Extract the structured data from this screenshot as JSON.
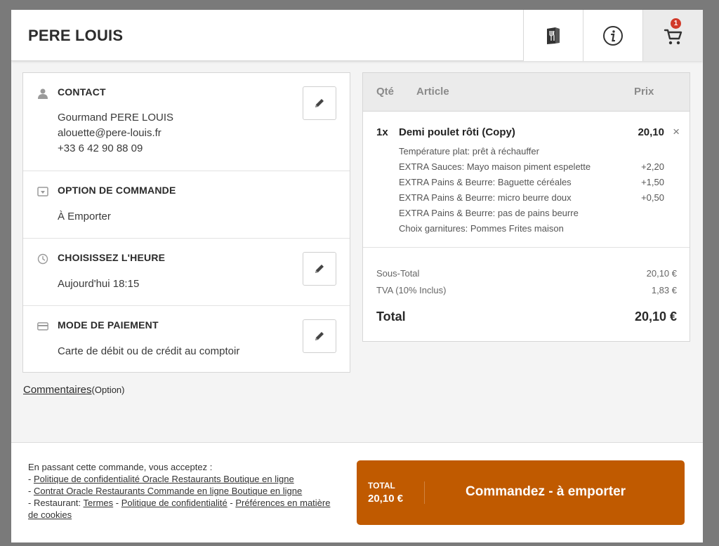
{
  "header": {
    "brand": "PERE LOUIS",
    "cart_count": "1",
    "icons": {
      "menu": "menu-book-icon",
      "info": "info-icon",
      "cart": "cart-icon"
    }
  },
  "contact": {
    "title": "CONTACT",
    "name": "Gourmand PERE LOUIS",
    "email": "alouette@pere-louis.fr",
    "phone": "+33 6 42 90 88 09"
  },
  "order_option": {
    "title": "OPTION DE COMMANDE",
    "value": "À Emporter"
  },
  "time": {
    "title": "CHOISISSEZ L'HEURE",
    "value": "Aujourd'hui 18:15"
  },
  "payment": {
    "title": "MODE DE PAIEMENT",
    "value": "Carte de débit ou de crédit au comptoir"
  },
  "comments": {
    "link": "Commentaires",
    "option": "(Option)"
  },
  "order": {
    "headers": {
      "qty": "Qté",
      "article": "Article",
      "price": "Prix"
    },
    "item": {
      "qty": "1x",
      "name": "Demi poulet rôti (Copy)",
      "price": "20,10",
      "remove": "×",
      "modifiers": [
        {
          "label": "Température plat: prêt à réchauffer",
          "price": ""
        },
        {
          "label": "EXTRA Sauces: Mayo maison piment espelette",
          "price": "+2,20"
        },
        {
          "label": "EXTRA Pains & Beurre: Baguette céréales",
          "price": "+1,50"
        },
        {
          "label": "EXTRA Pains & Beurre: micro beurre doux",
          "price": "+0,50"
        },
        {
          "label": "EXTRA Pains & Beurre: pas de pains beurre",
          "price": ""
        },
        {
          "label": "Choix garnitures: Pommes Frites maison",
          "price": ""
        }
      ]
    },
    "subtotal_label": "Sous-Total",
    "subtotal_value": "20,10 €",
    "tax_label": "TVA (10% Inclus)",
    "tax_value": "1,83 €",
    "total_label": "Total",
    "total_value": "20,10 €"
  },
  "footer": {
    "legal_intro": "En passant cette commande, vous acceptez :",
    "dash": "- ",
    "privacy_link": "Politique de confidentialité Oracle Restaurants Boutique en ligne",
    "contract_link": "Contrat Oracle Restaurants Commande en ligne Boutique en ligne",
    "restaurant_prefix": "- Restaurant: ",
    "terms_link": "Termes",
    "sep": " - ",
    "restaurant_privacy_link": "Politique de confidentialité",
    "cookies_link": "Préférences en matière de cookies"
  },
  "cta": {
    "total_label": "TOTAL",
    "total_value": "20,10 €",
    "label": "Commandez - à emporter"
  },
  "colors": {
    "accent": "#c05a00",
    "badge": "#d13a2a",
    "header_bg": "#ffffff",
    "backdrop": "#7a7a7a"
  }
}
